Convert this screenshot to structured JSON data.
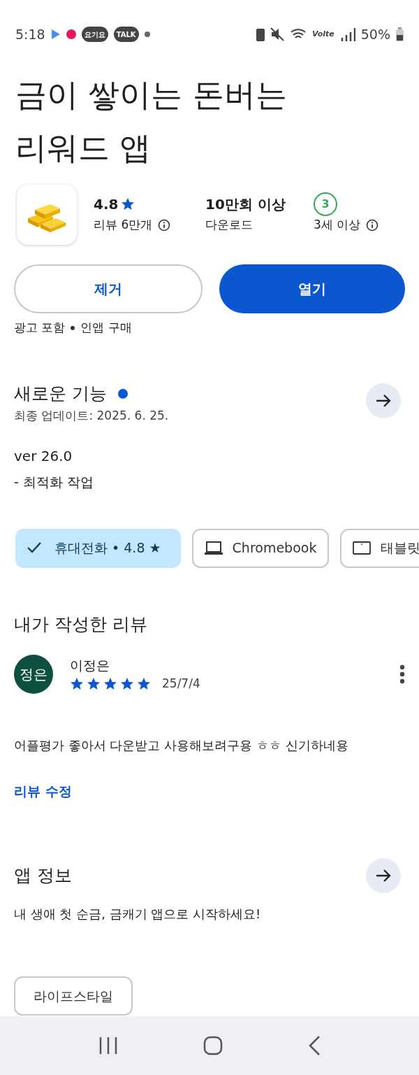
{
  "status_bar": {
    "time": "5:18",
    "badges": [
      "요기요",
      "TALK"
    ],
    "network": "Volte",
    "battery": "50%"
  },
  "app": {
    "title_lines": [
      "금이 쌓이는 돈버는",
      "리워드 앱"
    ],
    "stats": [
      {
        "value": "4.8",
        "star": true,
        "label": "리뷰 6만개",
        "info": true
      },
      {
        "value": "10만회 이상",
        "star": false,
        "label": "다운로드",
        "info": false
      },
      {
        "value": "3",
        "kind": "age",
        "label": "3세 이상",
        "info": true
      }
    ],
    "buttons": [
      {
        "label": "제거",
        "kind": "outline"
      },
      {
        "label": "열기",
        "kind": "filled"
      }
    ],
    "notes": [
      "광고 포함",
      "인앱 구매"
    ]
  },
  "whats_new": {
    "title": "새로운 기능",
    "new_dot": true,
    "updated": "최종 업데이트: 2025. 6. 25.",
    "version": "ver 26.0",
    "body": "- 최적화 작업"
  },
  "devices": [
    {
      "label": "휴대전화 • 4.8 ★",
      "kind": "phone",
      "selected": true
    },
    {
      "label": "Chromebook",
      "kind": "laptop",
      "selected": false
    },
    {
      "label": "태블릿",
      "kind": "tablet",
      "selected": false
    }
  ],
  "my_review": {
    "title": "내가 작성한 리뷰",
    "avatar": "정은",
    "author": "이정은",
    "stars": 5,
    "date": "25/7/4",
    "text": "어플평가 좋아서 다운받고 사용해보려구용 ㅎㅎ 신기하네용",
    "edit_link": "리뷰 수정"
  },
  "app_info": {
    "title": "앱 정보",
    "text": "내 생애 첫 순금, 금캐기 앱으로 시작하세요!",
    "tags": [
      "라이프스타일"
    ]
  }
}
